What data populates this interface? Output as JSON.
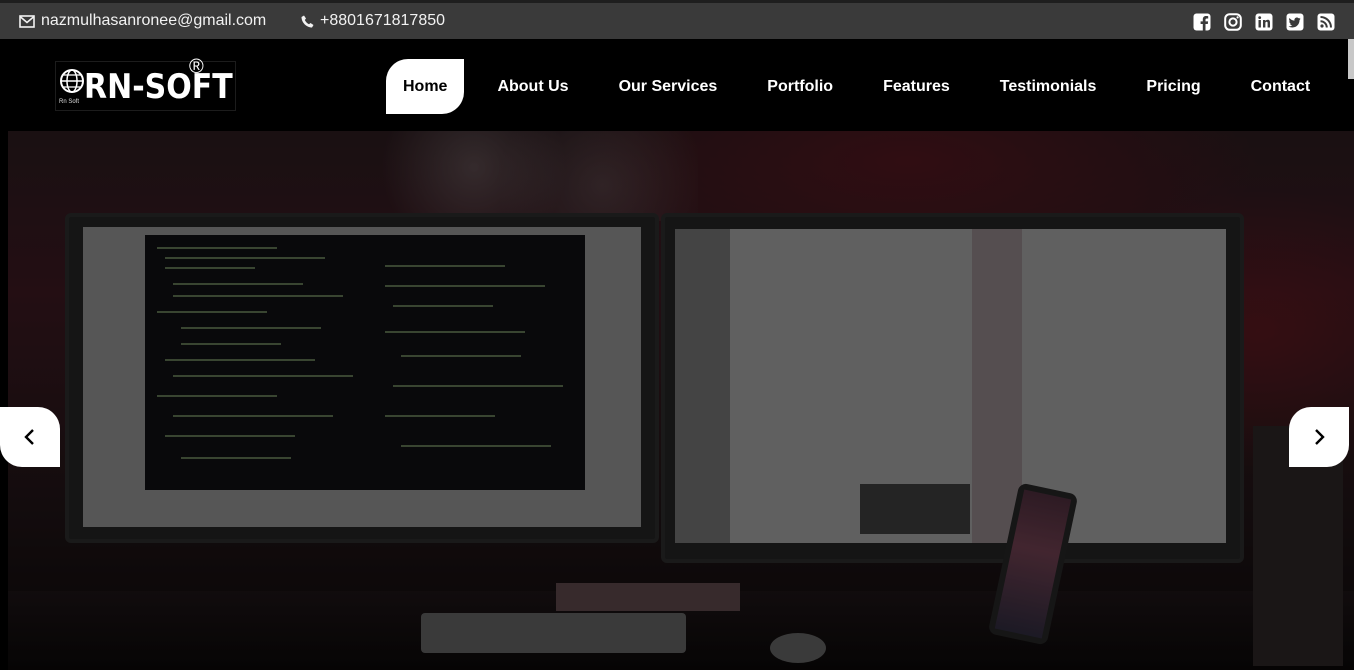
{
  "topbar": {
    "email": "nazmulhasanronee@gmail.com",
    "phone": "+8801671817850",
    "email_icon": "envelope-icon",
    "phone_icon": "phone-icon",
    "social": [
      "facebook-icon",
      "instagram-icon",
      "linkedin-icon",
      "twitter-icon",
      "rss-icon"
    ]
  },
  "logo": {
    "text": "RN-SOFT",
    "registered": "®",
    "tagline": "Rn Soft"
  },
  "nav": {
    "items": [
      {
        "label": "Home",
        "active": true
      },
      {
        "label": "About Us"
      },
      {
        "label": "Our Services"
      },
      {
        "label": "Portfolio"
      },
      {
        "label": "Features"
      },
      {
        "label": "Testimonials"
      },
      {
        "label": "Pricing"
      },
      {
        "label": "Contact"
      }
    ]
  },
  "slider": {
    "prev_icon": "chevron-left-icon",
    "next_icon": "chevron-right-icon"
  },
  "colors": {
    "topbar_bg": "#3a3a3a",
    "header_bg": "#000000",
    "active_bg": "#ffffff"
  }
}
